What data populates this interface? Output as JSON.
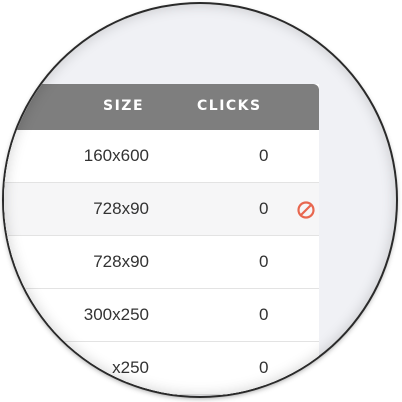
{
  "table": {
    "columns": {
      "size": "SIZE",
      "clicks": "CLICKS"
    },
    "rows": [
      {
        "size": "160x600",
        "clicks": "0",
        "blocked": false
      },
      {
        "size": "728x90",
        "clicks": "0",
        "blocked": true
      },
      {
        "size": "728x90",
        "clicks": "0",
        "blocked": false
      },
      {
        "size": "300x250",
        "clicks": "0",
        "blocked": false
      },
      {
        "size": "x250",
        "clicks": "0",
        "blocked": false
      }
    ]
  },
  "icons": {
    "blocked": "block-icon"
  },
  "colors": {
    "header_bg": "#7e7e7e",
    "header_text": "#ffffff",
    "block_icon": "#e8674f",
    "page_bg": "#f0f1f5"
  }
}
